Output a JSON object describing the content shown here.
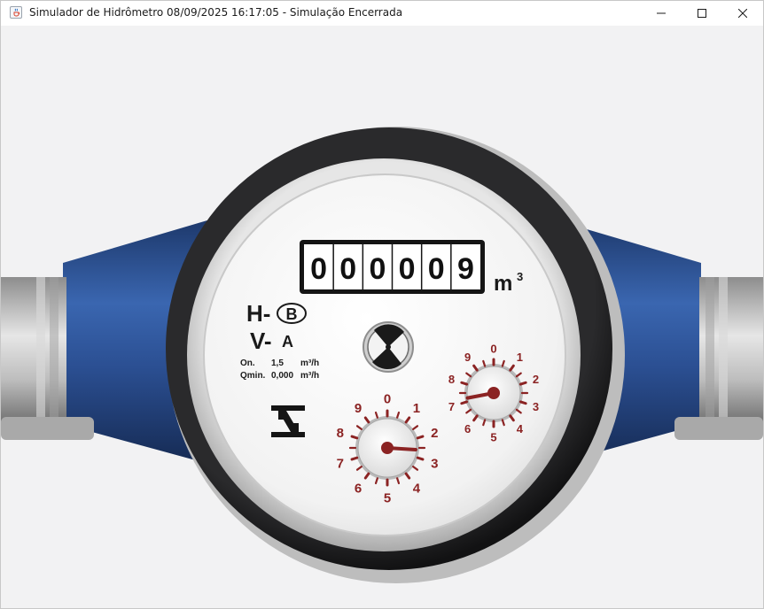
{
  "window": {
    "title": "Simulador de Hidrômetro 08/09/2025 16:17:05 - Simulação Encerrada",
    "icon": "java-cup-icon",
    "controls": [
      "minimize-icon",
      "maximize-icon",
      "close-icon"
    ]
  },
  "meter": {
    "odometer_digits": [
      "0",
      "0",
      "0",
      "0",
      "0",
      "9"
    ],
    "odometer_reading": 9,
    "unit_main": "m",
    "unit_sup": "3",
    "class_h_prefix": "H-",
    "class_h": "B",
    "class_v_prefix": "V-",
    "class_v": "A",
    "qn_label": "On.",
    "qn_value": "1,5",
    "qn_unit": "m³/h",
    "qmin_label": "Qmin.",
    "qmin_value": "0,000",
    "qmin_unit": "m³/h",
    "logo": "inmetro-logo-icon",
    "flow_indicator": "flow-star-wheel-icon",
    "dial_numbers": [
      "0",
      "1",
      "2",
      "3",
      "4",
      "5",
      "6",
      "7",
      "8",
      "9"
    ],
    "dial_large_value": 2.6,
    "dial_small_value": 7.2
  },
  "colors": {
    "pipe_blue": "#2a4d8f",
    "bezel_dark": "#1d1d1f",
    "dial_red": "#8b2323",
    "canvas_bg": "#f2f2f3"
  }
}
